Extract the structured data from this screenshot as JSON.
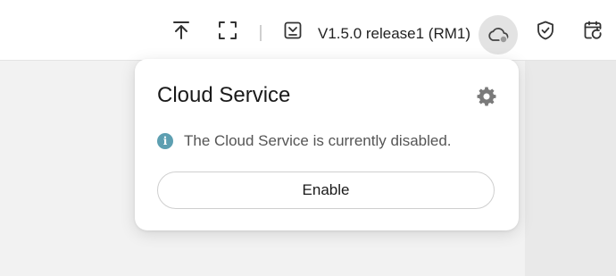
{
  "toolbar": {
    "icons": [
      "upload-icon",
      "fullscreen-icon",
      "download-icon",
      "cloud-icon",
      "shield-check-icon",
      "calendar-refresh-icon"
    ],
    "version_label": "V1.5.0 release1 (RM1)"
  },
  "popover": {
    "title": "Cloud Service",
    "status_text": "The Cloud Service is currently disabled.",
    "enable_label": "Enable",
    "settings_icon": "gear-icon",
    "info_icon": "info-icon"
  },
  "colors": {
    "info_accent": "#5d9fb1",
    "cloud_button_bg": "#e3e3e3"
  }
}
